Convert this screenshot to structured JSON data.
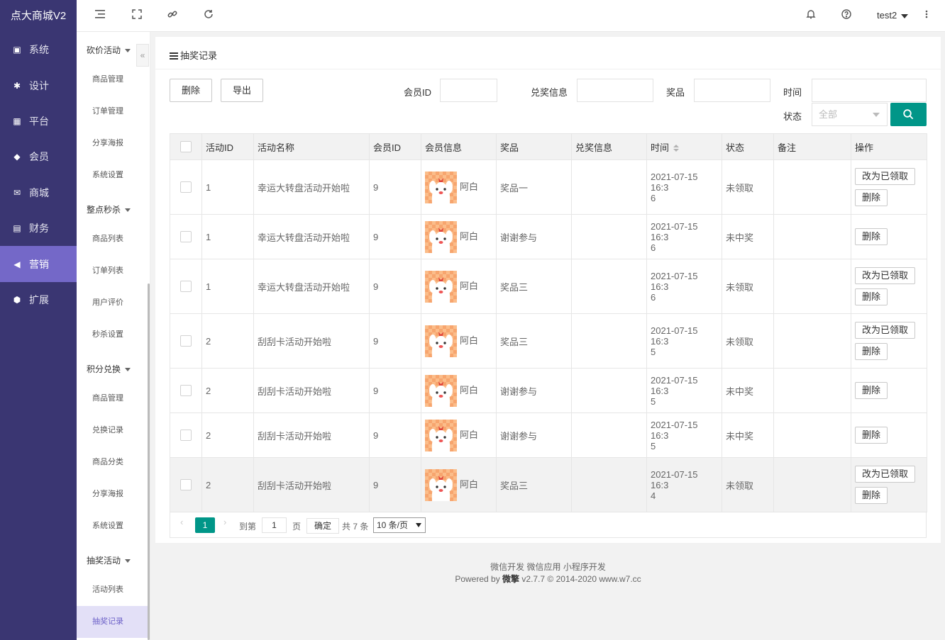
{
  "brand": "点大商城V2",
  "nav1": [
    {
      "label": "系统",
      "icon": "monitor-icon"
    },
    {
      "label": "设计",
      "icon": "puzzle-icon"
    },
    {
      "label": "平台",
      "icon": "grid-icon"
    },
    {
      "label": "会员",
      "icon": "diamond-icon"
    },
    {
      "label": "商城",
      "icon": "mail-icon"
    },
    {
      "label": "财务",
      "icon": "wallet-icon"
    },
    {
      "label": "营销",
      "icon": "megaphone-icon"
    },
    {
      "label": "扩展",
      "icon": "cube-icon"
    }
  ],
  "nav2": {
    "groups": [
      {
        "title": "砍价活动",
        "items": [
          "商品管理",
          "订单管理",
          "分享海报",
          "系统设置"
        ]
      },
      {
        "title": "整点秒杀",
        "items": [
          "商品列表",
          "订单列表",
          "用户评价",
          "秒杀设置"
        ]
      },
      {
        "title": "积分兑换",
        "items": [
          "商品管理",
          "兑换记录",
          "商品分类",
          "分享海报",
          "系统设置"
        ]
      },
      {
        "title": "抽奖活动",
        "items": [
          "活动列表",
          "抽奖记录"
        ]
      }
    ],
    "collapse": "«"
  },
  "topbar": {
    "user": "test2"
  },
  "card": {
    "title": "抽奖记录",
    "delete_btn": "删除",
    "export_btn": "导出",
    "filters": {
      "member_id": "会员ID",
      "exchange_info": "兑奖信息",
      "prize": "奖品",
      "time": "时间",
      "status": "状态",
      "status_value": "全部"
    }
  },
  "table": {
    "headers": [
      "活动ID",
      "活动名称",
      "会员ID",
      "会员信息",
      "奖品",
      "兑奖信息",
      "时间",
      "状态",
      "备注",
      "操作"
    ],
    "btn_mark": "改为已领取",
    "btn_delete": "删除",
    "rows": [
      {
        "aid": "1",
        "aname": "幸运大转盘活动开始啦",
        "mid": "9",
        "mname": "阿白",
        "prize": "奖品一",
        "exch": "",
        "time1": "2021-07-15 16:3",
        "time2": "6",
        "status": "未领取",
        "remark": "",
        "mark": true
      },
      {
        "aid": "1",
        "aname": "幸运大转盘活动开始啦",
        "mid": "9",
        "mname": "阿白",
        "prize": "谢谢参与",
        "exch": "",
        "time1": "2021-07-15 16:3",
        "time2": "6",
        "status": "未中奖",
        "remark": "",
        "mark": false
      },
      {
        "aid": "1",
        "aname": "幸运大转盘活动开始啦",
        "mid": "9",
        "mname": "阿白",
        "prize": "奖品三",
        "exch": "",
        "time1": "2021-07-15 16:3",
        "time2": "6",
        "status": "未领取",
        "remark": "",
        "mark": true
      },
      {
        "aid": "2",
        "aname": "刮刮卡活动开始啦",
        "mid": "9",
        "mname": "阿白",
        "prize": "奖品三",
        "exch": "",
        "time1": "2021-07-15 16:3",
        "time2": "5",
        "status": "未领取",
        "remark": "",
        "mark": true
      },
      {
        "aid": "2",
        "aname": "刮刮卡活动开始啦",
        "mid": "9",
        "mname": "阿白",
        "prize": "谢谢参与",
        "exch": "",
        "time1": "2021-07-15 16:3",
        "time2": "5",
        "status": "未中奖",
        "remark": "",
        "mark": false
      },
      {
        "aid": "2",
        "aname": "刮刮卡活动开始啦",
        "mid": "9",
        "mname": "阿白",
        "prize": "谢谢参与",
        "exch": "",
        "time1": "2021-07-15 16:3",
        "time2": "5",
        "status": "未中奖",
        "remark": "",
        "mark": false
      },
      {
        "aid": "2",
        "aname": "刮刮卡活动开始啦",
        "mid": "9",
        "mname": "阿白",
        "prize": "奖品三",
        "exch": "",
        "time1": "2021-07-15 16:3",
        "time2": "4",
        "status": "未领取",
        "remark": "",
        "mark": true
      }
    ]
  },
  "pager": {
    "current": "1",
    "goto": "到第",
    "page_value": "1",
    "page_unit": "页",
    "confirm": "确定",
    "total": "共 7 条",
    "per_page": "10 条/页"
  },
  "footer": {
    "links": "微信开发 微信应用 小程序开发",
    "powered": "Powered by",
    "brand": "微擎",
    "version": "v2.7.7 © 2014-2020 www.w7.cc"
  },
  "colors": {
    "sidebar": "#3a3672",
    "active": "#7468c8",
    "primary": "#009688",
    "danger": "#e00"
  }
}
